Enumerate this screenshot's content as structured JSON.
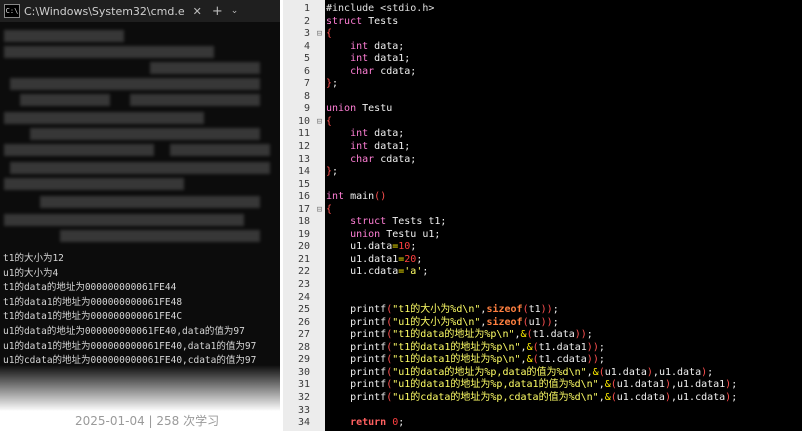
{
  "console": {
    "title": "C:\\Windows\\System32\\cmd.e",
    "close_glyph": "✕",
    "add_glyph": "+",
    "dropdown_glyph": "⌄",
    "output": [
      "t1的大小为12",
      "u1的大小为4",
      "t1的data的地址为000000000061FE44",
      "t1的data1的地址为000000000061FE48",
      "t1的data1的地址为000000000061FE4C",
      "u1的data的地址为000000000061FE40,data的值为97",
      "u1的data1的地址为000000000061FE40,data1的值为97",
      "u1的cdata的地址为000000000061FE40,cdata的值为97"
    ]
  },
  "article_meta": "2025-01-04 | 258 次学习",
  "editor": {
    "lines": [
      {
        "n": "1",
        "f": "",
        "t": [
          [
            "pp",
            "#include <stdio.h>"
          ]
        ]
      },
      {
        "n": "2",
        "f": "",
        "t": [
          [
            "kw",
            "struct"
          ],
          [
            "id",
            " Tests"
          ]
        ]
      },
      {
        "n": "3",
        "f": "⊟",
        "t": [
          [
            "br",
            "{"
          ]
        ]
      },
      {
        "n": "4",
        "f": "",
        "t": [
          [
            "typ",
            "    int"
          ],
          [
            "id",
            " data;"
          ]
        ]
      },
      {
        "n": "5",
        "f": "",
        "t": [
          [
            "typ",
            "    int"
          ],
          [
            "id",
            " data1;"
          ]
        ]
      },
      {
        "n": "6",
        "f": "",
        "t": [
          [
            "typ",
            "    char"
          ],
          [
            "id",
            " cdata;"
          ]
        ]
      },
      {
        "n": "7",
        "f": "",
        "t": [
          [
            "br",
            "}"
          ],
          [
            "id",
            ";"
          ]
        ]
      },
      {
        "n": "8",
        "f": "",
        "t": []
      },
      {
        "n": "9",
        "f": "",
        "t": [
          [
            "kw",
            "union"
          ],
          [
            "id",
            " Testu"
          ]
        ]
      },
      {
        "n": "10",
        "f": "⊟",
        "t": [
          [
            "br",
            "{"
          ]
        ]
      },
      {
        "n": "11",
        "f": "",
        "t": [
          [
            "typ",
            "    int"
          ],
          [
            "id",
            " data;"
          ]
        ]
      },
      {
        "n": "12",
        "f": "",
        "t": [
          [
            "typ",
            "    int"
          ],
          [
            "id",
            " data1;"
          ]
        ]
      },
      {
        "n": "13",
        "f": "",
        "t": [
          [
            "typ",
            "    char"
          ],
          [
            "id",
            " cdata;"
          ]
        ]
      },
      {
        "n": "14",
        "f": "",
        "t": [
          [
            "br",
            "}"
          ],
          [
            "id",
            ";"
          ]
        ]
      },
      {
        "n": "15",
        "f": "",
        "t": []
      },
      {
        "n": "16",
        "f": "",
        "t": [
          [
            "typ",
            "int"
          ],
          [
            "id",
            " main"
          ],
          [
            "br",
            "()"
          ]
        ]
      },
      {
        "n": "17",
        "f": "⊟",
        "t": [
          [
            "br",
            "{"
          ]
        ]
      },
      {
        "n": "18",
        "f": "",
        "t": [
          [
            "kw",
            "    struct"
          ],
          [
            "id",
            " Tests t1;"
          ]
        ]
      },
      {
        "n": "19",
        "f": "",
        "t": [
          [
            "kw",
            "    union"
          ],
          [
            "id",
            " Testu u1;"
          ]
        ]
      },
      {
        "n": "20",
        "f": "",
        "t": [
          [
            "id",
            "    u1.data"
          ],
          [
            "op",
            "="
          ],
          [
            "num",
            "10"
          ],
          [
            "id",
            ";"
          ]
        ]
      },
      {
        "n": "21",
        "f": "",
        "t": [
          [
            "id",
            "    u1.data1"
          ],
          [
            "op",
            "="
          ],
          [
            "num",
            "20"
          ],
          [
            "id",
            ";"
          ]
        ]
      },
      {
        "n": "22",
        "f": "",
        "t": [
          [
            "id",
            "    u1.cdata"
          ],
          [
            "op",
            "="
          ],
          [
            "str",
            "'a'"
          ],
          [
            "id",
            ";"
          ]
        ]
      },
      {
        "n": "23",
        "f": "",
        "t": []
      },
      {
        "n": "24",
        "f": "",
        "t": []
      },
      {
        "n": "25",
        "f": "",
        "t": [
          [
            "id",
            "    printf"
          ],
          [
            "br",
            "("
          ],
          [
            "str",
            "\"t1的大小为%d\\n\""
          ],
          [
            "id",
            ","
          ],
          [
            "kw2",
            "sizeof"
          ],
          [
            "br",
            "("
          ],
          [
            "id",
            "t1"
          ],
          [
            "br",
            "))"
          ],
          [
            "id",
            ";"
          ]
        ]
      },
      {
        "n": "26",
        "f": "",
        "t": [
          [
            "id",
            "    printf"
          ],
          [
            "br",
            "("
          ],
          [
            "str",
            "\"u1的大小为%d\\n\""
          ],
          [
            "id",
            ","
          ],
          [
            "kw2",
            "sizeof"
          ],
          [
            "br",
            "("
          ],
          [
            "id",
            "u1"
          ],
          [
            "br",
            "))"
          ],
          [
            "id",
            ";"
          ]
        ]
      },
      {
        "n": "27",
        "f": "",
        "t": [
          [
            "id",
            "    printf"
          ],
          [
            "br",
            "("
          ],
          [
            "str",
            "\"t1的data的地址为%p\\n\""
          ],
          [
            "id",
            ","
          ],
          [
            "op",
            "&"
          ],
          [
            "br",
            "("
          ],
          [
            "id",
            "t1.data"
          ],
          [
            "br",
            "))"
          ],
          [
            "id",
            ";"
          ]
        ]
      },
      {
        "n": "28",
        "f": "",
        "t": [
          [
            "id",
            "    printf"
          ],
          [
            "br",
            "("
          ],
          [
            "str",
            "\"t1的data1的地址为%p\\n\""
          ],
          [
            "id",
            ","
          ],
          [
            "op",
            "&"
          ],
          [
            "br",
            "("
          ],
          [
            "id",
            "t1.data1"
          ],
          [
            "br",
            "))"
          ],
          [
            "id",
            ";"
          ]
        ]
      },
      {
        "n": "29",
        "f": "",
        "t": [
          [
            "id",
            "    printf"
          ],
          [
            "br",
            "("
          ],
          [
            "str",
            "\"t1的data1的地址为%p\\n\""
          ],
          [
            "id",
            ","
          ],
          [
            "op",
            "&"
          ],
          [
            "br",
            "("
          ],
          [
            "id",
            "t1.cdata"
          ],
          [
            "br",
            "))"
          ],
          [
            "id",
            ";"
          ]
        ]
      },
      {
        "n": "30",
        "f": "",
        "t": [
          [
            "id",
            "    printf"
          ],
          [
            "br",
            "("
          ],
          [
            "str",
            "\"u1的data的地址为%p,data的值为%d\\n\""
          ],
          [
            "id",
            ","
          ],
          [
            "op",
            "&"
          ],
          [
            "br",
            "("
          ],
          [
            "id",
            "u1.data"
          ],
          [
            "br",
            ")"
          ],
          [
            "id",
            ",u1.data"
          ],
          [
            "br",
            ")"
          ],
          [
            "id",
            ";"
          ]
        ]
      },
      {
        "n": "31",
        "f": "",
        "t": [
          [
            "id",
            "    printf"
          ],
          [
            "br",
            "("
          ],
          [
            "str",
            "\"u1的data1的地址为%p,data1的值为%d\\n\""
          ],
          [
            "id",
            ","
          ],
          [
            "op",
            "&"
          ],
          [
            "br",
            "("
          ],
          [
            "id",
            "u1.data1"
          ],
          [
            "br",
            ")"
          ],
          [
            "id",
            ",u1.data1"
          ],
          [
            "br",
            ")"
          ],
          [
            "id",
            ";"
          ]
        ]
      },
      {
        "n": "32",
        "f": "",
        "t": [
          [
            "id",
            "    printf"
          ],
          [
            "br",
            "("
          ],
          [
            "str",
            "\"u1的cdata的地址为%p,cdata的值为%d\\n\""
          ],
          [
            "id",
            ","
          ],
          [
            "op",
            "&"
          ],
          [
            "br",
            "("
          ],
          [
            "id",
            "u1.cdata"
          ],
          [
            "br",
            ")"
          ],
          [
            "id",
            ",u1.cdata"
          ],
          [
            "br",
            ")"
          ],
          [
            "id",
            ";"
          ]
        ]
      },
      {
        "n": "33",
        "f": "",
        "t": []
      },
      {
        "n": "34",
        "f": "",
        "t": [
          [
            "kw3",
            "    return"
          ],
          [
            "id",
            " "
          ],
          [
            "num",
            "0"
          ],
          [
            "id",
            ";"
          ]
        ]
      }
    ]
  }
}
